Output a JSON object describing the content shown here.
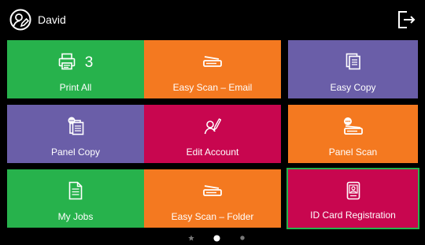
{
  "header": {
    "user_name": "David",
    "avatar_icon": "user-edit-icon",
    "logout_icon": "logout-icon"
  },
  "tiles": [
    {
      "label": "Print All",
      "count": "3",
      "icon": "printer-icon",
      "color": "#27b24c"
    },
    {
      "label": "Easy Scan – Email",
      "icon": "scanner-icon",
      "color": "#f47920"
    },
    {
      "label": "Easy Copy",
      "icon": "copy-document-icon",
      "color": "#6a5ea8"
    },
    {
      "label": "Panel Copy",
      "icon": "panel-copy-icon",
      "color": "#6a5ea8"
    },
    {
      "label": "Edit Account",
      "icon": "user-edit-icon",
      "color": "#c8064f"
    },
    {
      "label": "Panel Scan",
      "icon": "panel-scan-icon",
      "color": "#f47920"
    },
    {
      "label": "My Jobs",
      "icon": "document-icon",
      "color": "#27b24c"
    },
    {
      "label": "Easy Scan – Folder",
      "icon": "scanner-icon",
      "color": "#f47920"
    },
    {
      "label": "ID Card Registration",
      "icon": "id-card-icon",
      "color": "#c8064f",
      "selected": true
    }
  ],
  "pagination": {
    "pages": 3,
    "current": 2,
    "icons": [
      "star-icon",
      "dot-active-icon",
      "dot-icon"
    ]
  }
}
